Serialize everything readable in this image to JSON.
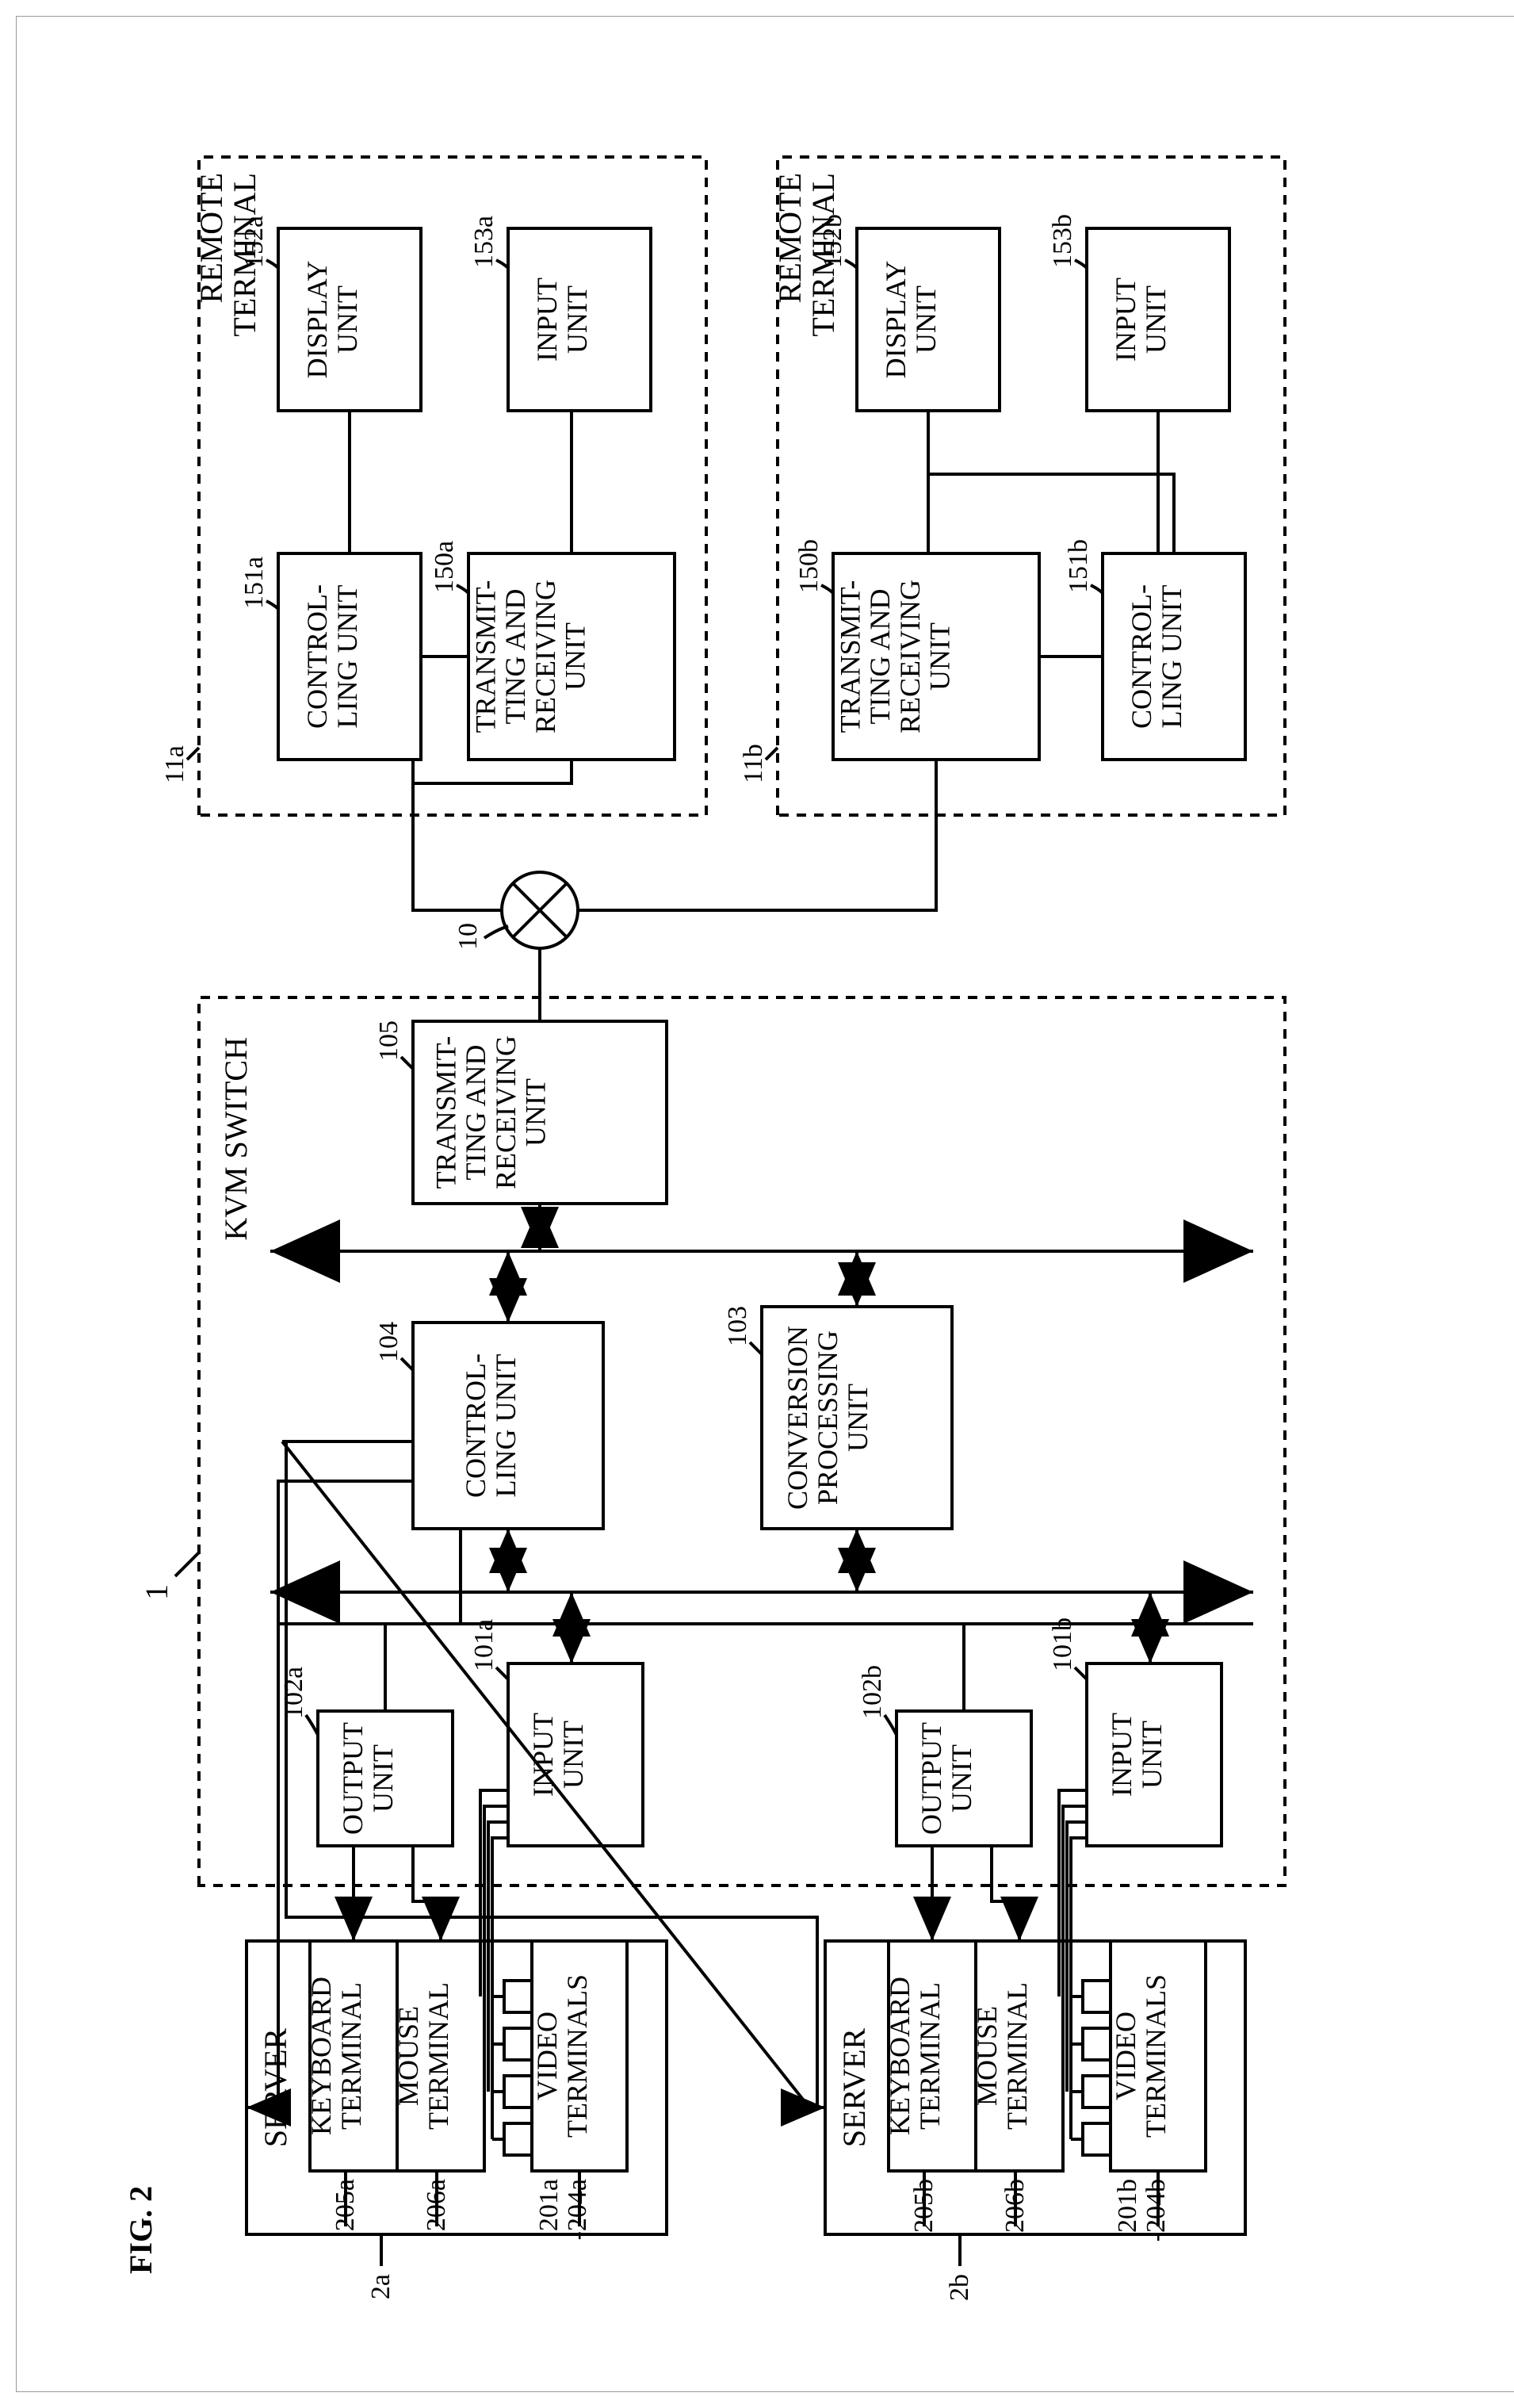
{
  "figure_title": "FIG. 2",
  "kvm_switch": {
    "label": "KVM SWITCH",
    "ref": "1",
    "output_unit_a": {
      "label": "OUTPUT\nUNIT",
      "ref": "102a"
    },
    "input_unit_a": {
      "label": "INPUT\nUNIT",
      "ref": "101a"
    },
    "output_unit_b": {
      "label": "OUTPUT\nUNIT",
      "ref": "102b"
    },
    "input_unit_b": {
      "label": "INPUT\nUNIT",
      "ref": "101b"
    },
    "controlling_unit": {
      "label": "CONTROL-\nLING UNIT",
      "ref": "104"
    },
    "conversion_unit": {
      "label": "CONVERSION\nPROCESSING\nUNIT",
      "ref": "103"
    },
    "txrx_unit": {
      "label": "TRANSMIT-\nTING AND\nRECEIVING\nUNIT",
      "ref": "105"
    }
  },
  "server_a": {
    "label": "SERVER",
    "ref": "2a",
    "keyboard": {
      "label": "KEYBOARD\nTERMINAL",
      "ref": "205a"
    },
    "mouse": {
      "label": "MOUSE\nTERMINAL",
      "ref": "206a"
    },
    "video": {
      "label": "VIDEO\nTERMINALS",
      "ref": "201a\n-204a"
    }
  },
  "server_b": {
    "label": "SERVER",
    "ref": "2b",
    "keyboard": {
      "label": "KEYBOARD\nTERMINAL",
      "ref": "205b"
    },
    "mouse": {
      "label": "MOUSE\nTERMINAL",
      "ref": "206b"
    },
    "video": {
      "label": "VIDEO\nTERMINALS",
      "ref": "201b\n-204b"
    }
  },
  "network_node": {
    "ref": "10"
  },
  "remote_a": {
    "label": "REMOTE\nTERMINAL",
    "ref": "11a",
    "controlling": {
      "label": "CONTROL-\nLING UNIT",
      "ref": "151a"
    },
    "display": {
      "label": "DISPLAY\nUNIT",
      "ref": "152a"
    },
    "txrx": {
      "label": "TRANSMIT-\nTING AND\nRECEIVING\nUNIT",
      "ref": "150a"
    },
    "input": {
      "label": "INPUT\nUNIT",
      "ref": "153a"
    }
  },
  "remote_b": {
    "label": "REMOTE\nTERMINAL",
    "ref": "11b",
    "controlling": {
      "label": "CONTROL-\nLING UNIT",
      "ref": "151b"
    },
    "display": {
      "label": "DISPLAY\nUNIT",
      "ref": "152b"
    },
    "txrx": {
      "label": "TRANSMIT-\nTING AND\nRECEIVING\nUNIT",
      "ref": "150b"
    },
    "input": {
      "label": "INPUT\nUNIT",
      "ref": "153b"
    }
  }
}
